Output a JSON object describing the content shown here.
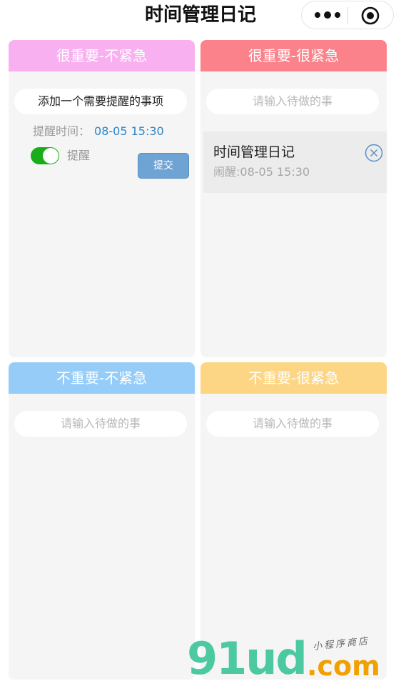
{
  "nav": {
    "title": "时间管理日记",
    "more_icon": "more-dots-icon",
    "target_icon": "target-icon"
  },
  "quadrants": [
    {
      "title": "很重要-不紧急",
      "color": "#f8b0f0",
      "input_value": "添加一个需要提醒的事项",
      "remind_label": "提醒时间：",
      "remind_time": "08-05 15:30",
      "switch_label": "提醒",
      "switch_on": true,
      "submit_label": "提交"
    },
    {
      "title": "很重要-很紧急",
      "color": "#fb828a",
      "input_placeholder": "请输入待做的事",
      "items": [
        {
          "title": "时间管理日记",
          "alarm": "闹醒:08-05 15:30",
          "icon": "close-circle-icon"
        }
      ]
    },
    {
      "title": "不重要-不紧急",
      "color": "#96ccf8",
      "input_placeholder": "请输入待做的事"
    },
    {
      "title": "不重要-很紧急",
      "color": "#fcd685",
      "input_placeholder": "请输入待做的事"
    }
  ],
  "watermark": {
    "logo": "91ud",
    "domain": ".com",
    "tagline": "小程序商店"
  }
}
